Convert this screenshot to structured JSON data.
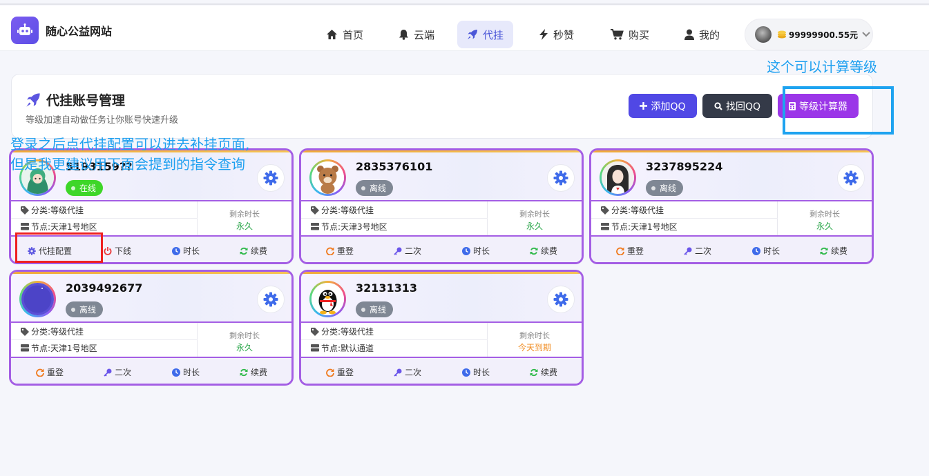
{
  "site": {
    "title": "随心公益网站"
  },
  "nav": [
    {
      "label": "首页",
      "icon": "home-icon"
    },
    {
      "label": "云端",
      "icon": "bell-icon"
    },
    {
      "label": "代挂",
      "icon": "rocket-icon",
      "active": true
    },
    {
      "label": "秒赞",
      "icon": "bolt-icon"
    },
    {
      "label": "购买",
      "icon": "cart-icon"
    },
    {
      "label": "我的",
      "icon": "user-icon"
    }
  ],
  "user": {
    "balance": "99999900.55元"
  },
  "panel": {
    "title": "代挂账号管理",
    "subtitle": "等级加速自动做任务让你账号快速升级"
  },
  "buttons": {
    "add": {
      "label": "添加QQ",
      "color": "#5048e5"
    },
    "find": {
      "label": "找回QQ",
      "color": "#343a48"
    },
    "calc": {
      "label": "等级计算器",
      "color": "#9b36e8"
    }
  },
  "labels": {
    "category": "分类: ",
    "node": "节点: ",
    "remaining": "剩余时长"
  },
  "cards": [
    {
      "qq": "5193159??",
      "status": "在线",
      "online": true,
      "category": "等级代挂",
      "node": "天津1号地区",
      "remaining": "永久",
      "actions": [
        "代挂配置",
        "下线",
        "时长",
        "续费"
      ]
    },
    {
      "qq": "2835376101",
      "status": "离线",
      "online": false,
      "category": "等级代挂",
      "node": "天津3号地区",
      "remaining": "永久",
      "actions": [
        "重登",
        "二次",
        "时长",
        "续费"
      ]
    },
    {
      "qq": "3237895224",
      "status": "离线",
      "online": false,
      "category": "等级代挂",
      "node": "天津1号地区",
      "remaining": "永久",
      "actions": [
        "重登",
        "二次",
        "时长",
        "续费"
      ]
    },
    {
      "qq": "2039492677",
      "status": "离线",
      "online": false,
      "category": "等级代挂",
      "node": "天津1号地区",
      "remaining": "永久",
      "actions": [
        "重登",
        "二次",
        "时长",
        "续费"
      ]
    },
    {
      "qq": "32131313",
      "status": "离线",
      "online": false,
      "category": "等级代挂",
      "node": "默认通道",
      "remaining": "今天到期",
      "actions": [
        "重登",
        "二次",
        "时长",
        "续费"
      ]
    }
  ],
  "annotations": {
    "calc_note": "这个可以计算等级",
    "config_note_line1": "登录之后点代挂配置可以进去补挂页面,",
    "config_note_line2": "但是我更建议用下面会提到的指令查询"
  },
  "colors": {
    "accent": "#a45ee4",
    "note": "#1ea0f0",
    "online": "#3ed629",
    "offline": "#7f8794",
    "remaining_ok": "#2aa64a",
    "remaining_warn": "#f08a1d"
  }
}
